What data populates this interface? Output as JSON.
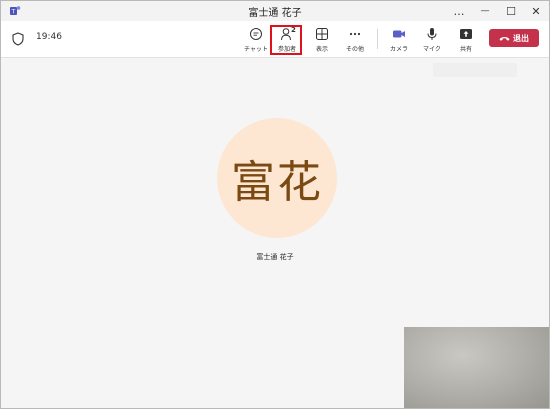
{
  "window": {
    "title": "富士通 花子",
    "more": "…",
    "minimize": "—",
    "maximize": "☐",
    "close": "✕"
  },
  "toolbar": {
    "timer": "19:46",
    "chat_label": "チャット",
    "people_label": "参加者",
    "people_count": "2",
    "view_label": "表示",
    "more_label": "その他",
    "camera_label": "カメラ",
    "mic_label": "マイク",
    "share_label": "共有",
    "leave_label": "退出",
    "icons": [
      "shield-icon",
      "chat-icon",
      "people-icon",
      "view-grid-icon",
      "more-dots-icon",
      "camera-icon",
      "mic-icon",
      "share-icon",
      "phone-hangup-icon"
    ],
    "colors": {
      "camera_accent": "#5b5fc7",
      "leave_bg": "#c4314b",
      "highlight": "#e0101d"
    }
  },
  "stage": {
    "avatar_initials": "富花",
    "participant_name": "富士通 花子",
    "colors": {
      "avatar_bg": "#fde7d3",
      "avatar_text": "#7a4a12"
    }
  }
}
